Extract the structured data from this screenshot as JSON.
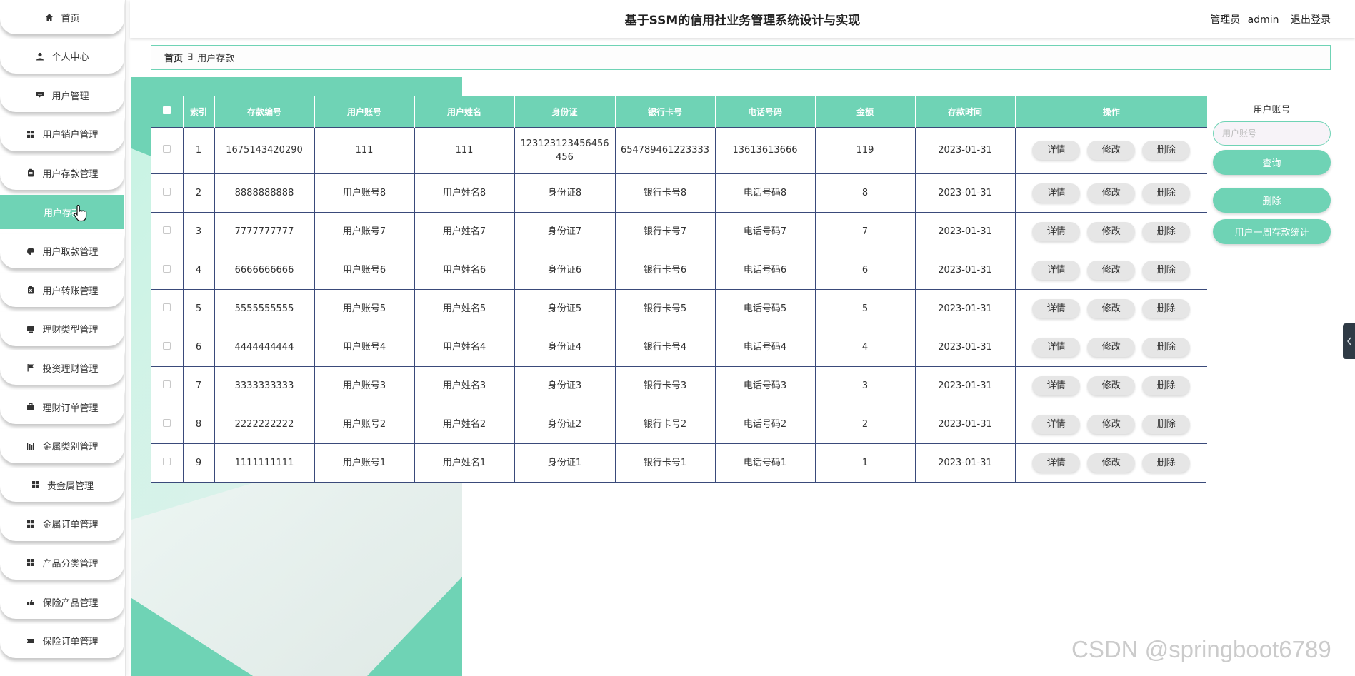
{
  "header": {
    "title": "基于SSM的信用社业务管理系统设计与实现",
    "user_role": "管理员",
    "user_name": "admin",
    "logout": "退出登录"
  },
  "sidebar": {
    "items": [
      {
        "label": "首页",
        "icon": "home-icon"
      },
      {
        "label": "个人中心",
        "icon": "user-icon"
      },
      {
        "label": "用户管理",
        "icon": "comment-icon"
      },
      {
        "label": "用户销户管理",
        "icon": "grid-icon"
      },
      {
        "label": "用户存款管理",
        "icon": "clipboard-icon"
      },
      {
        "label": "用户存款",
        "icon": "",
        "active": true
      },
      {
        "label": "用户取款管理",
        "icon": "palette-icon"
      },
      {
        "label": "用户转账管理",
        "icon": "clipboard-x-icon"
      },
      {
        "label": "理财类型管理",
        "icon": "monitor-icon"
      },
      {
        "label": "投资理财管理",
        "icon": "flag-icon"
      },
      {
        "label": "理财订单管理",
        "icon": "briefcase-icon"
      },
      {
        "label": "金属类别管理",
        "icon": "bar-chart-icon"
      },
      {
        "label": "贵金属管理",
        "icon": "grid-icon"
      },
      {
        "label": "金属订单管理",
        "icon": "grid-icon"
      },
      {
        "label": "产品分类管理",
        "icon": "grid-icon"
      },
      {
        "label": "保险产品管理",
        "icon": "hand-icon"
      },
      {
        "label": "保险订单管理",
        "icon": "ticket-icon"
      }
    ]
  },
  "breadcrumb": {
    "home": "首页",
    "separator": "∃",
    "current": "用户存款"
  },
  "table": {
    "columns": [
      "索引",
      "存款编号",
      "用户账号",
      "用户姓名",
      "身份证",
      "银行卡号",
      "电话号码",
      "金额",
      "存款时间",
      "操作"
    ],
    "rows": [
      [
        "1",
        "1675143420290",
        "111",
        "111",
        "123123123456456456",
        "654789461223333",
        "13613613666",
        "119",
        "2023-01-31"
      ],
      [
        "2",
        "8888888888",
        "用户账号8",
        "用户姓名8",
        "身份证8",
        "银行卡号8",
        "电话号码8",
        "8",
        "2023-01-31"
      ],
      [
        "3",
        "7777777777",
        "用户账号7",
        "用户姓名7",
        "身份证7",
        "银行卡号7",
        "电话号码7",
        "7",
        "2023-01-31"
      ],
      [
        "4",
        "6666666666",
        "用户账号6",
        "用户姓名6",
        "身份证6",
        "银行卡号6",
        "电话号码6",
        "6",
        "2023-01-31"
      ],
      [
        "5",
        "5555555555",
        "用户账号5",
        "用户姓名5",
        "身份证5",
        "银行卡号5",
        "电话号码5",
        "5",
        "2023-01-31"
      ],
      [
        "6",
        "4444444444",
        "用户账号4",
        "用户姓名4",
        "身份证4",
        "银行卡号4",
        "电话号码4",
        "4",
        "2023-01-31"
      ],
      [
        "7",
        "3333333333",
        "用户账号3",
        "用户姓名3",
        "身份证3",
        "银行卡号3",
        "电话号码3",
        "3",
        "2023-01-31"
      ],
      [
        "8",
        "2222222222",
        "用户账号2",
        "用户姓名2",
        "身份证2",
        "银行卡号2",
        "电话号码2",
        "2",
        "2023-01-31"
      ],
      [
        "9",
        "1111111111",
        "用户账号1",
        "用户姓名1",
        "身份证1",
        "银行卡号1",
        "电话号码1",
        "1",
        "2023-01-31"
      ]
    ],
    "actions": {
      "detail": "详情",
      "edit": "修改",
      "delete": "删除"
    }
  },
  "search": {
    "label": "用户账号",
    "placeholder": "用户账号",
    "value": "",
    "query_button": "查询",
    "delete_button": "删除",
    "stats_button": "用户一周存款统计"
  },
  "watermark": "CSDN @springboot6789",
  "colors": {
    "accent": "#6fd3b5",
    "table_border": "#3a4a7a",
    "op_button": "#e6e6e6"
  }
}
